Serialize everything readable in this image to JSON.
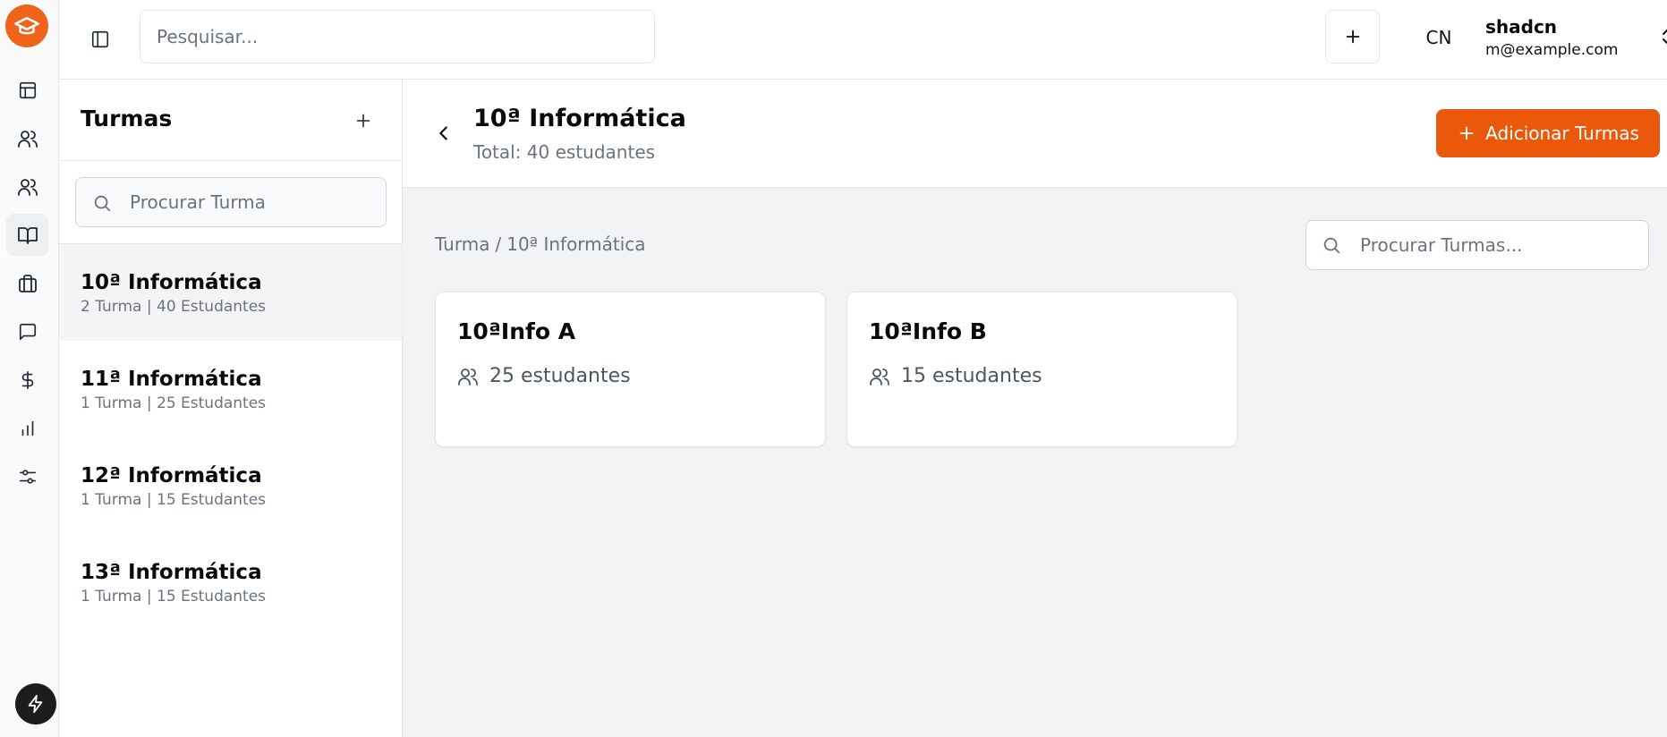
{
  "topbar": {
    "search_placeholder": "Pesquisar...",
    "user": {
      "initials": "CN",
      "name": "shadcn",
      "email": "m@example.com"
    }
  },
  "rail": {
    "items": [
      {
        "icon": "layout-icon",
        "active": false
      },
      {
        "icon": "users-icon",
        "active": false
      },
      {
        "icon": "users-icon",
        "active": false
      },
      {
        "icon": "book-open-icon",
        "active": true
      },
      {
        "icon": "briefcase-icon",
        "active": false
      },
      {
        "icon": "message-icon",
        "active": false
      },
      {
        "icon": "dollar-icon",
        "active": false
      },
      {
        "icon": "bar-chart-icon",
        "active": false
      },
      {
        "icon": "sliders-icon",
        "active": false
      }
    ],
    "accent": "#f0641a"
  },
  "panel": {
    "title": "Turmas",
    "search_placeholder": "Procurar Turma",
    "classes": [
      {
        "name": "10ª Informática",
        "meta": "2 Turma | 40 Estudantes",
        "active": true
      },
      {
        "name": "11ª Informática",
        "meta": "1 Turma | 25 Estudantes",
        "active": false
      },
      {
        "name": "12ª Informática",
        "meta": "1 Turma | 15 Estudantes",
        "active": false
      },
      {
        "name": "13ª Informática",
        "meta": "1 Turma | 15 Estudantes",
        "active": false
      }
    ]
  },
  "main": {
    "title": "10ª Informática",
    "subtitle": "Total: 40 estudantes",
    "add_button_label": "Adicionar Turmas",
    "breadcrumb": {
      "root": "Turma",
      "sep": "/",
      "current": "10ª Informática"
    },
    "search_placeholder": "Procurar Turmas...",
    "cards": [
      {
        "title": "10ªInfo A",
        "count": "25 estudantes"
      },
      {
        "title": "10ªInfo B",
        "count": "15 estudantes"
      }
    ]
  },
  "colors": {
    "primary": "#ea580c",
    "muted_text": "#6b7280",
    "content_bg": "#f2f3f5"
  }
}
